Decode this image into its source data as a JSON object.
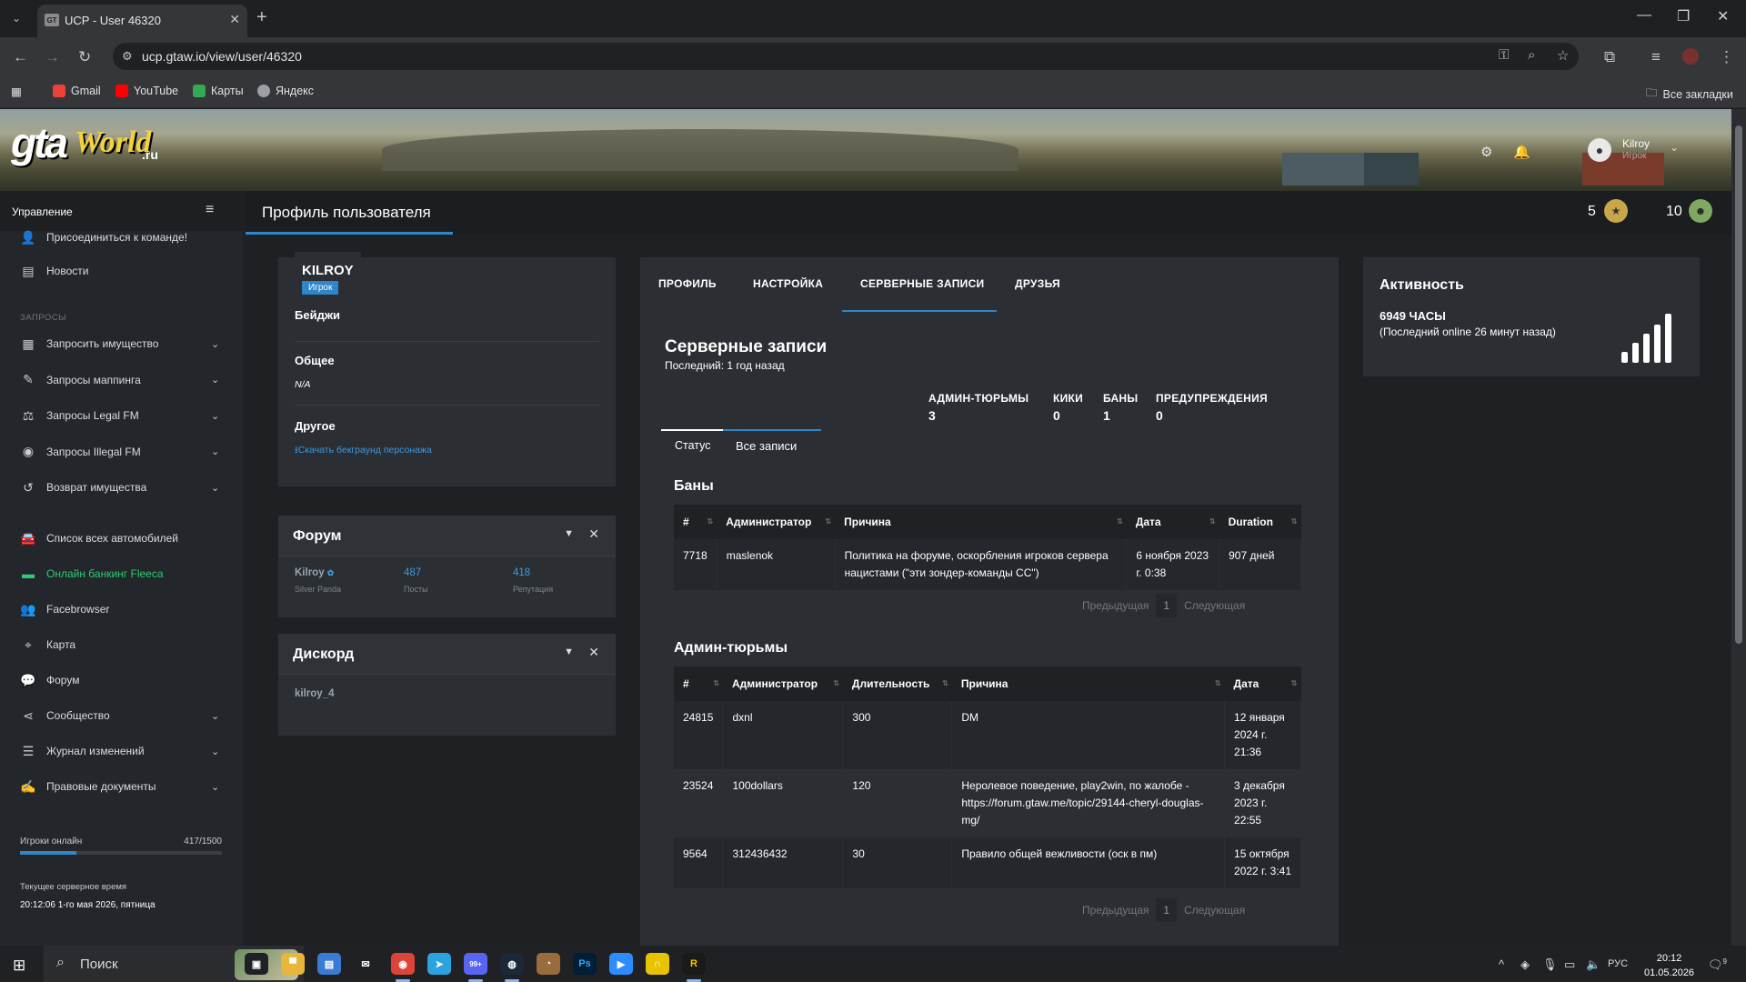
{
  "browser": {
    "tab_title": "UCP - User 46320",
    "favicon": "GT",
    "url": "ucp.gtaw.io/view/user/46320",
    "bookmarks": [
      "Gmail",
      "YouTube",
      "Карты",
      "Яндекс"
    ],
    "all_bookmarks": "Все закладки",
    "bookmark_colors": [
      "#ea4335",
      "#ff0000",
      "#34a853",
      "#9aa0a6"
    ]
  },
  "site": {
    "logo_main": "gta",
    "logo_world": "World",
    "logo_ru": ".ru",
    "user_name": "Kilroy",
    "user_role": "Игрок"
  },
  "sidebar": {
    "header": "Управление",
    "items_top": [
      {
        "icon": "user-plus-icon",
        "label": "Присоединиться к команде!"
      },
      {
        "icon": "news-icon",
        "label": "Новости"
      }
    ],
    "section_label": "ЗАПРОСЫ",
    "requests": [
      {
        "icon": "building-icon",
        "label": "Запросить имущество"
      },
      {
        "icon": "brush-icon",
        "label": "Запросы маппинга"
      },
      {
        "icon": "scale-icon",
        "label": "Запросы Legal FM"
      },
      {
        "icon": "mask-icon",
        "label": "Запросы Illegal FM"
      },
      {
        "icon": "undo-icon",
        "label": "Возврат имущества"
      }
    ],
    "items_bottom": [
      {
        "icon": "car-icon",
        "label": "Список всех автомобилей"
      },
      {
        "icon": "bank-icon",
        "label": "Онлайн банкинг Fleeca"
      },
      {
        "icon": "users-icon",
        "label": "Facebrowser"
      },
      {
        "icon": "map-icon",
        "label": "Карта"
      },
      {
        "icon": "comments-icon",
        "label": "Форум"
      },
      {
        "icon": "share-icon",
        "label": "Сообщество"
      },
      {
        "icon": "list-icon",
        "label": "Журнал изменений"
      },
      {
        "icon": "document-icon",
        "label": "Правовые документы"
      }
    ],
    "online_label": "Игроки онлайн",
    "online_value": "417/1500",
    "online_fraction": 0.278,
    "server_time_label": "Текущее серверное время",
    "server_time": "20:12:06 1-го мая 2026, пятница"
  },
  "header": {
    "title": "Профиль пользователя",
    "medal1_count": "5",
    "medal2_count": "10"
  },
  "profile": {
    "name": "KILROY",
    "badge": "Игрок",
    "badges_label": "Бейджи",
    "general_label": "Общее",
    "general_value": "N/A",
    "other_label": "Другое",
    "download_link": "Скачать бекграунд персонажа"
  },
  "forum": {
    "title": "Форум",
    "username": "Kilroy",
    "rank": "Silver Panda",
    "posts": "487",
    "posts_label": "Посты",
    "reputation": "418",
    "reputation_label": "Репутация"
  },
  "discord": {
    "title": "Дискорд",
    "username": "kilroy_4"
  },
  "tabs": [
    "ПРОФИЛЬ",
    "НАСТРОЙКА",
    "СЕРВЕРНЫЕ ЗАПИСИ",
    "ДРУЗЬЯ"
  ],
  "records": {
    "title": "Серверные записи",
    "last": "Последний: 1 год назад",
    "stats": [
      {
        "label": "АДМИН-ТЮРЬМЫ",
        "value": "3"
      },
      {
        "label": "КИКИ",
        "value": "0"
      },
      {
        "label": "БАНЫ",
        "value": "1"
      },
      {
        "label": "ПРЕДУПРЕЖДЕНИЯ",
        "value": "0"
      }
    ],
    "subtabs": [
      "Статус",
      "Все записи"
    ],
    "bans_title": "Баны",
    "bans_headers": [
      "#",
      "Администратор",
      "Причина",
      "Дата",
      "Duration"
    ],
    "bans_rows": [
      [
        "7718",
        "maslenok",
        "Политика на форуме, оскорбления игроков сервера нацистами (\"эти зондер-команды СС\")",
        "6 ноября 2023 г. 0:38",
        "907 дней"
      ]
    ],
    "jails_title": "Админ-тюрьмы",
    "jails_headers": [
      "#",
      "Администратор",
      "Длительность",
      "Причина",
      "Дата"
    ],
    "jails_rows": [
      [
        "24815",
        "dxnl",
        "300",
        "DM",
        "12 января 2024 г. 21:36"
      ],
      [
        "23524",
        "100dollars",
        "120",
        "Неролевое поведение, play2win, по жалобе - https://forum.gtaw.me/topic/29144-cheryl-douglas-mg/",
        "3 декабря 2023 г. 22:55"
      ],
      [
        "9564",
        "312436432",
        "30",
        "Правило общей вежливости (оск в пм)",
        "15 октября 2022 г. 3:41"
      ]
    ],
    "pager_prev": "Предыдущая",
    "pager_num": "1",
    "pager_next": "Следующая"
  },
  "activity": {
    "title": "Активность",
    "hours": "6949 ЧАСЫ",
    "last_online": "(Последний online 26 минут назад)"
  },
  "taskbar": {
    "search_placeholder": "Поиск",
    "apps": [
      "task-view-icon",
      "file-explorer-icon",
      "store-icon",
      "mail-icon",
      "chrome-icon",
      "telegram-icon",
      "discord-icon",
      "steam-icon",
      "app-icon",
      "photoshop-icon",
      "zoom-icon",
      "headphones-icon",
      "rockstar-icon"
    ],
    "app_labels": [
      "",
      "",
      "",
      "",
      "",
      "",
      "99+",
      "",
      "",
      "Ps",
      "",
      "",
      "R"
    ],
    "lang": "РУС",
    "time": "20:12",
    "date": "01.05.2026",
    "notif_count": "9"
  }
}
